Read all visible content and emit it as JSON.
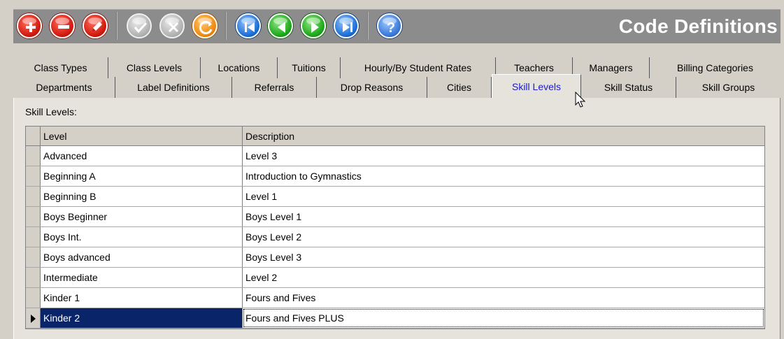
{
  "app": {
    "title": "Code Definitions"
  },
  "toolbar": {
    "buttons": [
      {
        "name": "add-record-button",
        "color": "#d21a0e",
        "icon": "plus-icon"
      },
      {
        "name": "delete-record-button",
        "color": "#d21a0e",
        "icon": "minus-icon"
      },
      {
        "name": "edit-record-button",
        "color": "#d21a0e",
        "icon": "pencil-icon"
      },
      {
        "name": "save-record-button",
        "color": "#b3b3b3",
        "icon": "check-icon"
      },
      {
        "name": "cancel-record-button",
        "color": "#b3b3b3",
        "icon": "x-icon"
      },
      {
        "name": "refresh-button",
        "color": "#f08a10",
        "icon": "refresh-icon"
      },
      {
        "name": "first-record-button",
        "color": "#1d6fd6",
        "icon": "first-icon"
      },
      {
        "name": "previous-record-button",
        "color": "#1ea81a",
        "icon": "previous-icon"
      },
      {
        "name": "next-record-button",
        "color": "#1ea81a",
        "icon": "next-icon"
      },
      {
        "name": "last-record-button",
        "color": "#1d6fd6",
        "icon": "last-icon"
      },
      {
        "name": "help-button",
        "color": "#3a79d8",
        "icon": "help-icon"
      }
    ]
  },
  "tabs": {
    "row1": [
      "Class Types",
      "Class Levels",
      "Locations",
      "Tuitions",
      "Hourly/By Student Rates",
      "Teachers",
      "Managers",
      "Billing Categories"
    ],
    "row2": [
      "Departments",
      "Label Definitions",
      "Referrals",
      "Drop Reasons",
      "Cities",
      "Skill Levels",
      "Skill Status",
      "Skill Groups"
    ],
    "active": "Skill Levels"
  },
  "panel": {
    "label": "Skill Levels:",
    "columns": {
      "level": "Level",
      "description": "Description"
    },
    "rows": [
      {
        "level": "Advanced",
        "description": "Level 3"
      },
      {
        "level": "Beginning A",
        "description": "Introduction to Gymnastics"
      },
      {
        "level": "Beginning B",
        "description": "Level 1"
      },
      {
        "level": "Boys Beginner",
        "description": "Boys Level 1"
      },
      {
        "level": "Boys Int.",
        "description": "Boys Level 2"
      },
      {
        "level": "Boys advanced",
        "description": "Boys Level 3"
      },
      {
        "level": "Intermediate",
        "description": "Level 2"
      },
      {
        "level": "Kinder 1",
        "description": "Fours and Fives"
      },
      {
        "level": "Kinder 2",
        "description": "Fours and Fives PLUS"
      }
    ],
    "selected_row": 8
  }
}
